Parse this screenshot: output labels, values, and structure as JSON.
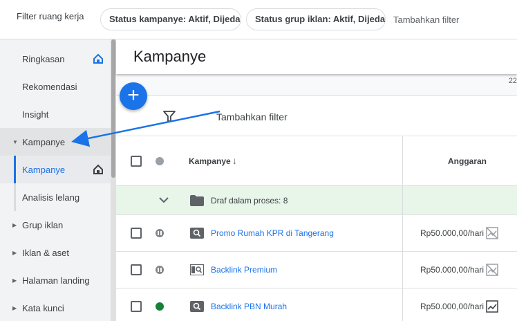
{
  "filter_bar": {
    "label": "Filter ruang kerja",
    "chips": [
      "Status kampanye: Aktif, Dijeda",
      "Status grup iklan: Aktif, Dijeda"
    ],
    "add_filter": "Tambahkan filter"
  },
  "sidebar": {
    "items": [
      {
        "label": "Ringkasan"
      },
      {
        "label": "Rekomendasi"
      },
      {
        "label": "Insight"
      },
      {
        "label": "Kampanye"
      },
      {
        "label": "Kampanye"
      },
      {
        "label": "Analisis lelang"
      },
      {
        "label": "Grup iklan"
      },
      {
        "label": "Iklan & aset"
      },
      {
        "label": "Halaman landing"
      },
      {
        "label": "Kata kunci"
      }
    ]
  },
  "main": {
    "title": "Kampanye",
    "under_num": "22",
    "fab_label": "+",
    "filter_add": "Tambahkan filter",
    "columns": {
      "campaign": "Kampanye",
      "budget": "Anggaran"
    },
    "group": {
      "label": "Draf dalam proses: 8"
    },
    "rows": [
      {
        "name": "Promo Rumah KPR di Tangerang",
        "budget": "Rp50.000,00/hari",
        "status": "paused"
      },
      {
        "name": "Backlink Premium",
        "budget": "Rp50.000,00/hari",
        "status": "paused"
      },
      {
        "name": "Backlink PBN Murah",
        "budget": "Rp50.000,00/hari",
        "status": "active"
      }
    ]
  },
  "colors": {
    "accent": "#1a73e8",
    "active": "#188038",
    "paused": "#80868b",
    "draft_bg": "#e8f5e9"
  }
}
